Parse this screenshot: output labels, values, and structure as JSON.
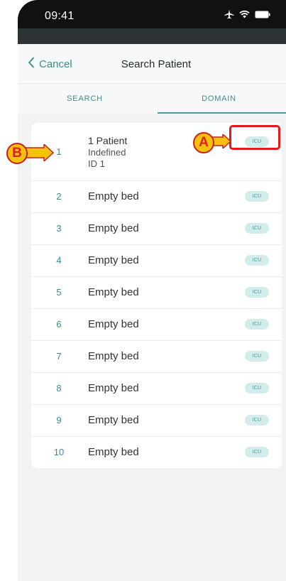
{
  "status_bar": {
    "time": "09:41",
    "icons": [
      "airplane-icon",
      "wifi-icon",
      "battery-icon"
    ]
  },
  "header": {
    "cancel_label": "Cancel",
    "title": "Search Patient"
  },
  "tabs": [
    {
      "label": "SEARCH",
      "active": false
    },
    {
      "label": "DOMAIN",
      "active": true
    }
  ],
  "beds": [
    {
      "number": "1",
      "name": "1 Patient",
      "line2": "Indefined",
      "line3": "ID 1",
      "badge": "ICU"
    },
    {
      "number": "2",
      "name": "Empty bed",
      "badge": "ICU"
    },
    {
      "number": "3",
      "name": "Empty bed",
      "badge": "ICU"
    },
    {
      "number": "4",
      "name": "Empty bed",
      "badge": "ICU"
    },
    {
      "number": "5",
      "name": "Empty bed",
      "badge": "ICU"
    },
    {
      "number": "6",
      "name": "Empty bed",
      "badge": "ICU"
    },
    {
      "number": "7",
      "name": "Empty bed",
      "badge": "ICU"
    },
    {
      "number": "8",
      "name": "Empty bed",
      "badge": "ICU"
    },
    {
      "number": "9",
      "name": "Empty bed",
      "badge": "ICU"
    },
    {
      "number": "10",
      "name": "Empty bed",
      "badge": "ICU"
    }
  ],
  "callouts": {
    "a": "A",
    "b": "B"
  },
  "colors": {
    "accent": "#3b8a8f",
    "callout_fill": "#f4c20d",
    "callout_border": "#e21a1a"
  }
}
